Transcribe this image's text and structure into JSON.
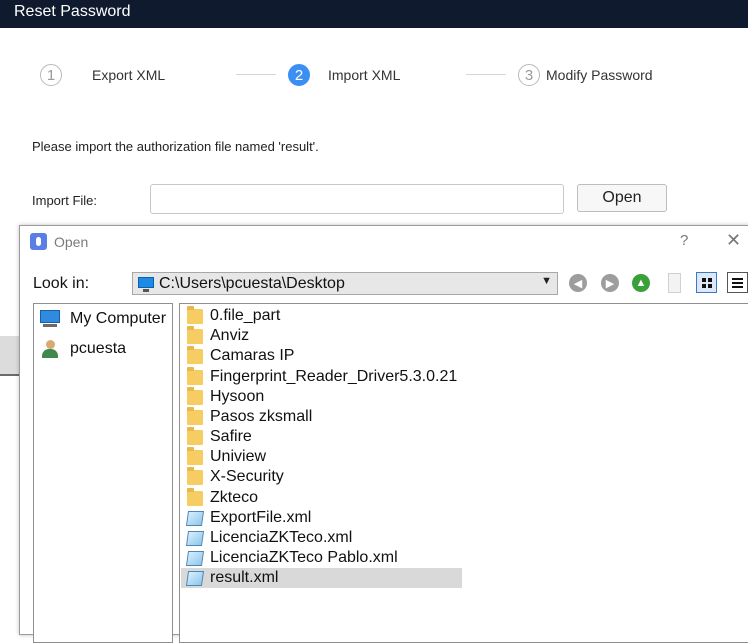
{
  "window": {
    "title": "Reset Password"
  },
  "steps": [
    {
      "number": "1",
      "label": "Export XML"
    },
    {
      "number": "2",
      "label": "Import XML"
    },
    {
      "number": "3",
      "label": "Modify Password"
    }
  ],
  "active_step": 2,
  "instruction": "Please import the authorization file named 'result'.",
  "import": {
    "label": "Import File:",
    "value": "",
    "button_label": "Open"
  },
  "dialog": {
    "title": "Open",
    "help_label": "?",
    "close_label": "✕",
    "look_in_label": "Look in:",
    "look_in_path": "C:\\Users\\pcuesta\\Desktop",
    "side_items": [
      {
        "label": "My Computer",
        "icon": "computer-icon"
      },
      {
        "label": "pcuesta",
        "icon": "user-folder-icon"
      }
    ],
    "files": [
      {
        "name": "0.file_part",
        "type": "folder"
      },
      {
        "name": "Anviz",
        "type": "folder"
      },
      {
        "name": "Camaras IP",
        "type": "folder"
      },
      {
        "name": "Fingerprint_Reader_Driver5.3.0.21",
        "type": "folder"
      },
      {
        "name": "Hysoon",
        "type": "folder"
      },
      {
        "name": "Pasos zksmall",
        "type": "folder"
      },
      {
        "name": "Safire",
        "type": "folder"
      },
      {
        "name": "Uniview",
        "type": "folder"
      },
      {
        "name": "X-Security",
        "type": "folder"
      },
      {
        "name": "Zkteco",
        "type": "folder"
      },
      {
        "name": "ExportFile.xml",
        "type": "xml"
      },
      {
        "name": "LicenciaZKTeco.xml",
        "type": "xml"
      },
      {
        "name": "LicenciaZKTeco Pablo.xml",
        "type": "xml"
      },
      {
        "name": "result.xml",
        "type": "xml",
        "selected": true
      }
    ]
  },
  "colors": {
    "titlebar": "#0f1a2e",
    "active_step": "#3b8ff3",
    "selection": "#d9d9d9"
  }
}
